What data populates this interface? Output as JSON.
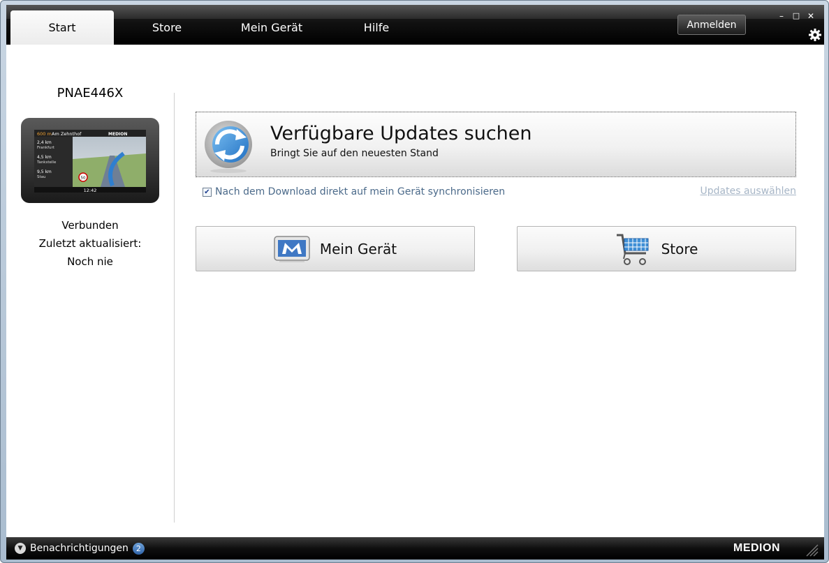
{
  "tabs": [
    {
      "label": "Start",
      "active": true
    },
    {
      "label": "Store",
      "active": false
    },
    {
      "label": "Mein Gerät",
      "active": false
    },
    {
      "label": "Hilfe",
      "active": false
    }
  ],
  "header": {
    "login_label": "Anmelden",
    "minimize_symbol": "–",
    "maximize_symbol": "□",
    "close_symbol": "✕",
    "settings_icon": "gear-icon"
  },
  "device": {
    "name": "PNAE446X",
    "status": "Verbunden",
    "last_updated_label": "Zuletzt aktualisiert:",
    "last_updated_value": "Noch nie",
    "screen": {
      "brand": "MEDION",
      "distance_header": "600 m",
      "street": "Am Zehnthof",
      "route_1_distance": "2,4 km",
      "route_1_name": "Frankfurt",
      "route_2_distance": "4,5 km",
      "route_2_name": "Tankstelle",
      "route_3_distance": "9,5 km",
      "route_3_name": "Stau",
      "speed_limit": "50",
      "time": "12:42"
    }
  },
  "updates": {
    "title": "Verfügbare Updates suchen",
    "subtitle": "Bringt Sie auf den neuesten Stand",
    "sync_checkbox_checked": true,
    "sync_label": "Nach dem Download direkt auf mein Gerät synchronisieren",
    "select_link": "Updates auswählen"
  },
  "actions": {
    "device_label": "Mein Gerät",
    "store_label": "Store"
  },
  "footer": {
    "notifications_label": "Benachrichtigungen",
    "notifications_count": "2",
    "brand": "MEDION"
  },
  "colors": {
    "link_blue": "#4b6a8a",
    "link_disabled": "#a6b5c6",
    "badge_blue": "#2f63a8",
    "update_icon_blue": "#2f7fcf"
  }
}
